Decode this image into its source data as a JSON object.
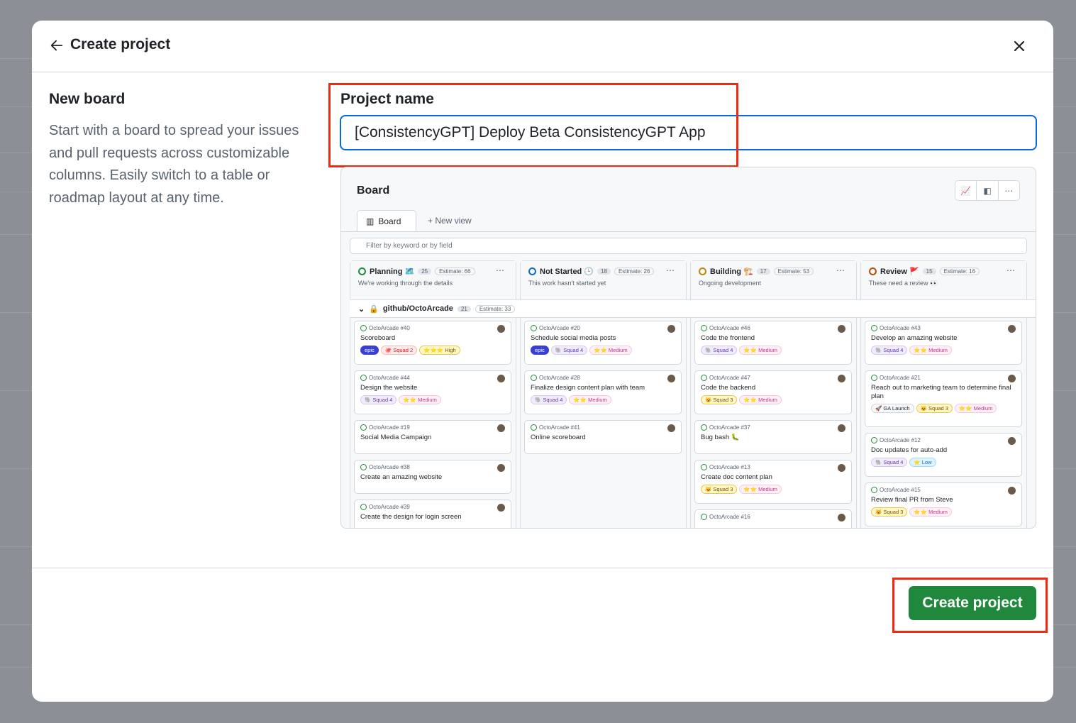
{
  "header": {
    "title": "Create project"
  },
  "left": {
    "heading": "New board",
    "description": "Start with a board to spread your issues and pull requests across customizable columns. Easily switch to a table or roadmap layout at any time."
  },
  "form": {
    "label": "Project name",
    "value": "[ConsistencyGPT] Deploy Beta ConsistencyGPT App"
  },
  "preview": {
    "title": "Board",
    "tab": "Board",
    "new_view": "New view",
    "filter_placeholder": "Filter by keyword or by field",
    "group": {
      "name": "github/OctoArcade",
      "count": "21",
      "estimate": "Estimate: 33"
    },
    "columns": [
      {
        "name": "Planning 🗺️",
        "count": "25",
        "estimate": "Estimate: 66",
        "desc": "We're working through the details",
        "color": "#1f883d",
        "cards": [
          {
            "ref": "OctoArcade #40",
            "title": "Scoreboard",
            "labels": [
              "epic",
              "🐙 Squad 2",
              "⭐⭐⭐ High"
            ]
          },
          {
            "ref": "OctoArcade #44",
            "title": "Design the website",
            "labels": [
              "🐘 Squad 4",
              "⭐⭐ Medium"
            ]
          },
          {
            "ref": "OctoArcade #19",
            "title": "Social Media Campaign",
            "labels": []
          },
          {
            "ref": "OctoArcade #38",
            "title": "Create an amazing website",
            "labels": []
          },
          {
            "ref": "OctoArcade #39",
            "title": "Create the design for login screen",
            "labels": []
          }
        ]
      },
      {
        "name": "Not Started 🕒",
        "count": "18",
        "estimate": "Estimate: 26",
        "desc": "This work hasn't started yet",
        "color": "#0969da",
        "cards": [
          {
            "ref": "OctoArcade #20",
            "title": "Schedule social media posts",
            "labels": [
              "epic",
              "🐘 Squad 4",
              "⭐⭐ Medium"
            ]
          },
          {
            "ref": "OctoArcade #28",
            "title": "Finalize design content plan with team",
            "labels": [
              "🐘 Squad 4",
              "⭐⭐ Medium"
            ]
          },
          {
            "ref": "OctoArcade #41",
            "title": "Online scoreboard",
            "labels": []
          }
        ]
      },
      {
        "name": "Building 🏗️",
        "count": "17",
        "estimate": "Estimate: 53",
        "desc": "Ongoing development",
        "color": "#bf8700",
        "cards": [
          {
            "ref": "OctoArcade #46",
            "title": "Code the frontend",
            "labels": [
              "🐘 Squad 4",
              "⭐⭐ Medium"
            ]
          },
          {
            "ref": "OctoArcade #47",
            "title": "Code the backend",
            "labels": [
              "😺 Squad 3",
              "⭐⭐ Medium"
            ]
          },
          {
            "ref": "OctoArcade #37",
            "title": "Bug bash 🐛",
            "labels": []
          },
          {
            "ref": "OctoArcade #13",
            "title": "Create doc content plan",
            "labels": [
              "😺 Squad 3",
              "⭐⭐ Medium"
            ]
          },
          {
            "ref": "OctoArcade #16",
            "title": "",
            "labels": []
          }
        ]
      },
      {
        "name": "Review 🚩",
        "count": "15",
        "estimate": "Estimate: 16",
        "desc": "These need a review 👀",
        "color": "#bc4c00",
        "cards": [
          {
            "ref": "OctoArcade #43",
            "title": "Develop an amazing website",
            "labels": [
              "🐘 Squad 4",
              "⭐⭐ Medium"
            ]
          },
          {
            "ref": "OctoArcade #21",
            "title": "Reach out to marketing team to determine final plan",
            "labels": [
              "🚀 GA Launch",
              "😺 Squad 3",
              "⭐⭐ Medium"
            ]
          },
          {
            "ref": "OctoArcade #12",
            "title": "Doc updates for auto-add",
            "labels": [
              "🐘 Squad 4",
              "⭐ Low"
            ]
          },
          {
            "ref": "OctoArcade #15",
            "title": "Review final PR from Steve",
            "labels": [
              "😺 Squad 3",
              "⭐⭐ Medium"
            ]
          }
        ]
      }
    ]
  },
  "footer": {
    "create_label": "Create project"
  },
  "colors": {
    "primary": "#1f883d",
    "focus": "#0969da",
    "highlight": "#ee2b10"
  }
}
